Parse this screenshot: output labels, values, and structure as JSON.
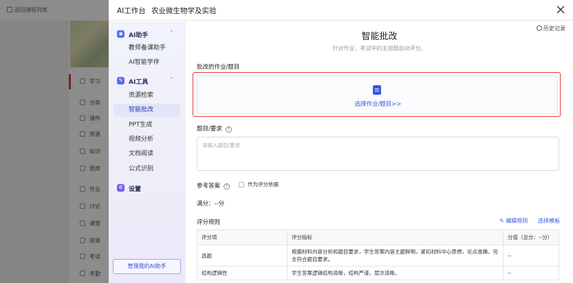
{
  "background": {
    "back_label": "返回课程列表",
    "menu_items": [
      "学习",
      "分类",
      "课件",
      "资源",
      "知识",
      "题库",
      "作业",
      "讨论",
      "课堂",
      "资源",
      "考试",
      "考勤"
    ]
  },
  "dialog": {
    "title": "AI工作台",
    "course": "农业微生物学及实验"
  },
  "sidebar": {
    "groups": [
      {
        "label": "AI助手",
        "icon": "robot-icon",
        "items": [
          {
            "label": "教师备课助手"
          },
          {
            "label": "AI智能学伴"
          }
        ]
      },
      {
        "label": "AI工具",
        "icon": "tool-icon",
        "items": [
          {
            "label": "资源检索"
          },
          {
            "label": "智能批改",
            "active": true
          },
          {
            "label": "PPT生成"
          },
          {
            "label": "视频分析"
          },
          {
            "label": "文档阅读"
          },
          {
            "label": "公式识别"
          }
        ]
      },
      {
        "label": "设置",
        "icon": "settings-icon",
        "items": []
      }
    ],
    "manage_button": "管理我的AI助手"
  },
  "main": {
    "history": "历史记录",
    "title": "智能批改",
    "subtitle": "针对作业、考试中的主观题自动评分。",
    "assignment_label": "批改的作业/题目",
    "upload_text": "选择作业/题目>>",
    "question_label": "题目/要求",
    "question_placeholder": "请输入题目/要求",
    "answer_label": "参考答案",
    "answer_checkbox": "作为评分依据",
    "full_score": "满分：--分",
    "rules_label": "评分规则",
    "edit_rules": "编辑规则",
    "select_template": "选择模板",
    "table": {
      "headers": [
        "评分项",
        "评分指标",
        "分值（总分：--分）"
      ],
      "rows": [
        [
          "选题",
          "根据材料内容分析和题目要求，学生答案内容主题鲜明，紧扣材料中心思想，论点准确，完全符合题目要求。",
          "--"
        ],
        [
          "结构逻辑性",
          "学生答案逻辑结构清晰，结构严谨，层次清晰。",
          "--"
        ]
      ]
    }
  },
  "colors": {
    "accent": "#3b5bdb",
    "highlight": "#e53935",
    "sidebar_bg": "#eef0fa"
  }
}
